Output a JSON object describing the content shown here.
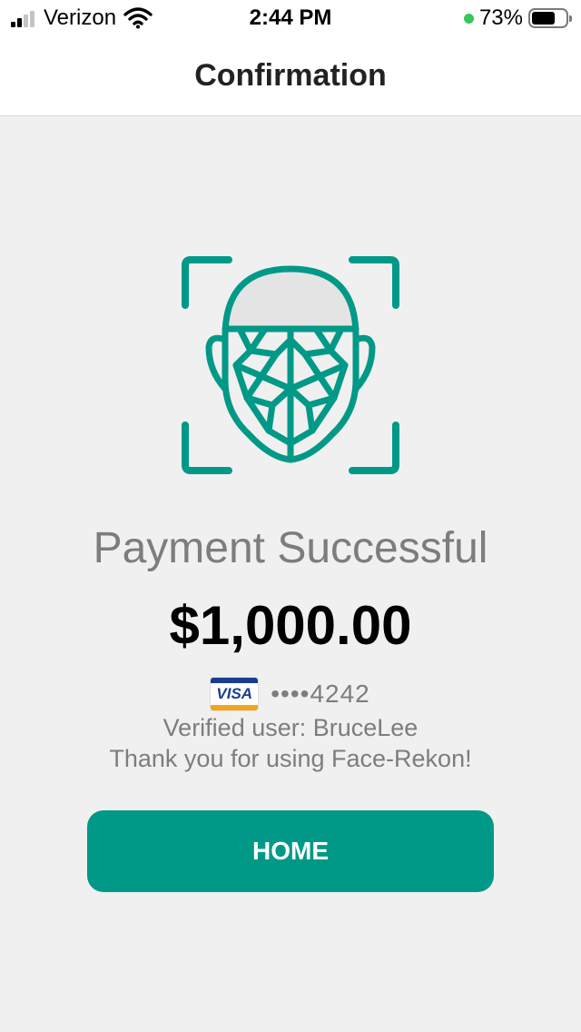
{
  "status_bar": {
    "carrier": "Verizon",
    "time": "2:44 PM",
    "battery_percent": "73%",
    "battery_level": 0.73,
    "signal_bars": 2,
    "icons": [
      "signal-icon",
      "wifi-icon",
      "battery-icon"
    ]
  },
  "nav": {
    "title": "Confirmation"
  },
  "confirmation": {
    "icon": "face-scan-icon",
    "headline": "Payment Successful",
    "amount": "$1,000.00",
    "card_brand": "VISA",
    "card_number": "••••4242",
    "verified_text": "Verified user: BruceLee",
    "thanks_text": "Thank you for using Face-Rekon!"
  },
  "actions": {
    "home_label": "HOME"
  },
  "colors": {
    "accent": "#009987",
    "text_muted": "#7d7d7d",
    "background": "#f0f0f0"
  }
}
